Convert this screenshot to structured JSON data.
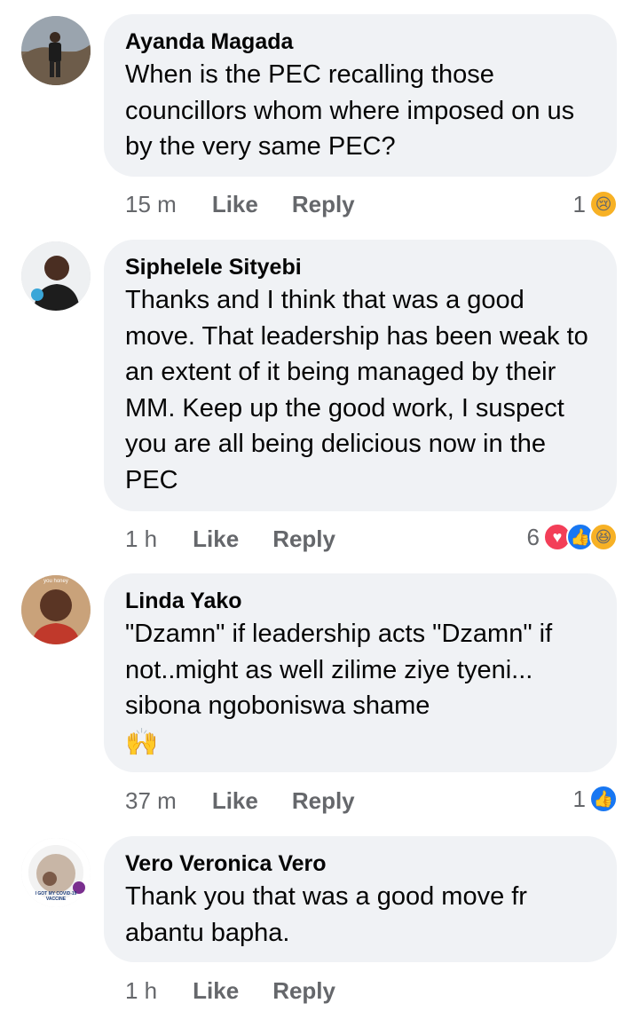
{
  "comments": [
    {
      "author": "Ayanda Magada",
      "text": "When is the PEC recalling those councillors whom where imposed on us by the very same PEC?",
      "emoji_line": "",
      "time": "15 m",
      "like_label": "Like",
      "reply_label": "Reply",
      "reaction_count": "1",
      "reactions": [
        "sad"
      ]
    },
    {
      "author": "Siphelele Sityebi",
      "text": "Thanks and I think that was a good move. That leadership has been weak to an extent of it being managed by their MM. Keep up the good work, I suspect you are all being delicious now in the PEC",
      "emoji_line": "",
      "time": "1 h",
      "like_label": "Like",
      "reply_label": "Reply",
      "reaction_count": "6",
      "reactions": [
        "love",
        "like",
        "haha"
      ]
    },
    {
      "author": "Linda Yako",
      "text": "\"Dzamn\" if leadership acts \"Dzamn\" if not..might as well zilime ziye tyeni... sibona ngoboniswa shame",
      "emoji_line": "🙌",
      "time": "37 m",
      "like_label": "Like",
      "reply_label": "Reply",
      "reaction_count": "1",
      "reactions": [
        "like"
      ]
    },
    {
      "author": "Vero Veronica Vero",
      "text": "Thank you that was a good move fr abantu bapha.",
      "emoji_line": "",
      "time": "1 h",
      "like_label": "Like",
      "reply_label": "Reply",
      "reaction_count": "",
      "reactions": []
    }
  ],
  "avatar_badges": {
    "linda": "you honey",
    "vero": "I GOT MY COVID-19 VACCINE"
  },
  "colors": {
    "bubble": "#f0f2f5",
    "meta": "#65676b",
    "like_blue": "#1877f2",
    "love_red": "#f33e58",
    "emoji_yellow": "#f7b125"
  }
}
